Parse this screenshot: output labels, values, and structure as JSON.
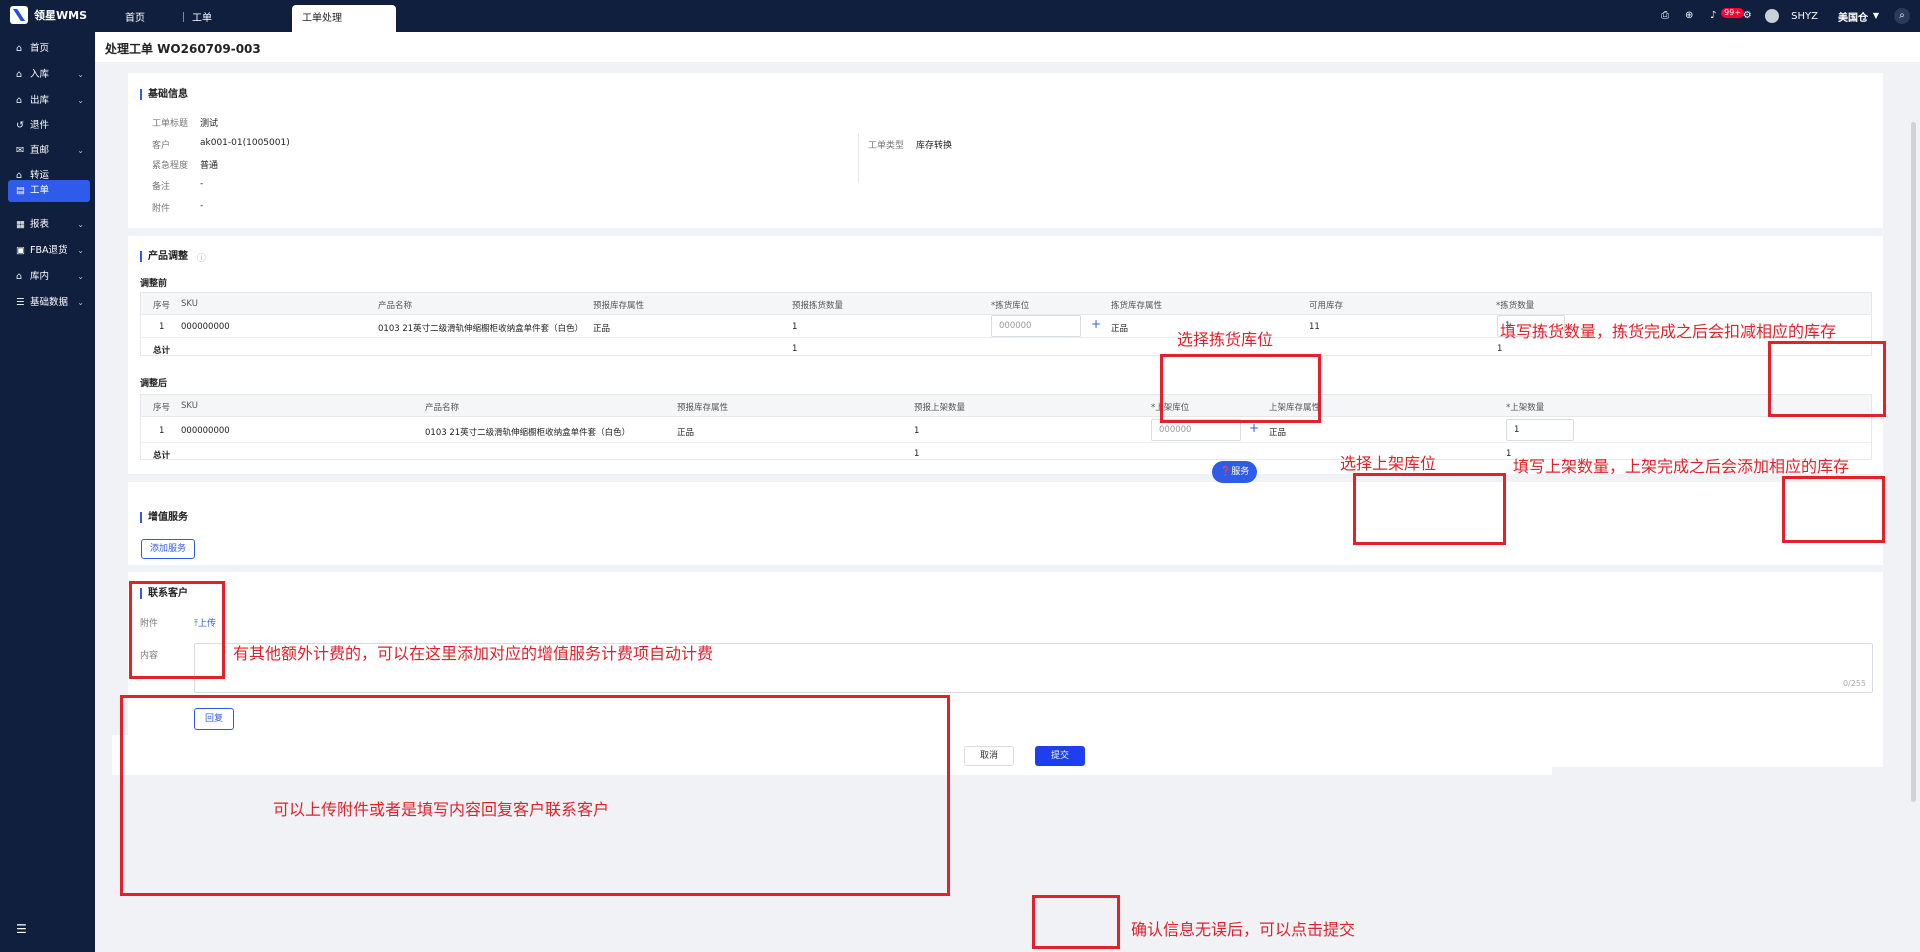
{
  "topbar": {
    "brand": "领星WMS",
    "tabs": [
      {
        "label": "首页"
      },
      {
        "label": "工单"
      },
      {
        "label": "工单处理"
      }
    ],
    "notif_count": "99+",
    "user": "SHYZ",
    "warehouse": "美国仓"
  },
  "sidebar": {
    "items": [
      {
        "label": "首页",
        "icon": "home-icon"
      },
      {
        "label": "入库",
        "icon": "inbound-icon"
      },
      {
        "label": "出库",
        "icon": "outbound-icon"
      },
      {
        "label": "退件",
        "icon": "return-icon"
      },
      {
        "label": "直邮",
        "icon": "direct-mail-icon"
      },
      {
        "label": "转运",
        "icon": "transfer-icon"
      },
      {
        "label": "工单",
        "icon": "workorder-icon"
      },
      {
        "label": "报表",
        "icon": "report-icon"
      },
      {
        "label": "FBA退货",
        "icon": "fba-return-icon"
      },
      {
        "label": "库内",
        "icon": "inventory-icon"
      },
      {
        "label": "基础数据",
        "icon": "base-data-icon"
      }
    ]
  },
  "page": {
    "title": "处理工单 WO260709-003"
  },
  "basic": {
    "title": "基础信息",
    "fields": [
      {
        "label": "工单标题",
        "value": "测试"
      },
      {
        "label": "客户",
        "value": "ak001-01(1005001)"
      },
      {
        "label": "紧急程度",
        "value": "普通"
      },
      {
        "label": "备注",
        "value": "-"
      },
      {
        "label": "附件",
        "value": "-"
      }
    ],
    "type_label": "工单类型",
    "type_value": "库存转换"
  },
  "adjust": {
    "title": "产品调整",
    "before_label": "调整前",
    "before_headers": [
      "序号",
      "SKU",
      "产品名称",
      "预报库存属性",
      "预报拣货数量",
      "*拣货库位",
      "拣货库存属性",
      "可用库存",
      "*拣货数量"
    ],
    "before_row": {
      "no": "1",
      "sku": "000000000",
      "name": "0103 21英寸二级滑轨伸缩橱柜收纳盒单件套（白色）",
      "attr": "正品",
      "qty": "1",
      "loc": "000000",
      "loc_attr": "正品",
      "avail": "11",
      "pick": "1"
    },
    "before_total": {
      "label": "总计",
      "qty": "1",
      "pick": "1"
    },
    "after_label": "调整后",
    "after_headers": [
      "序号",
      "SKU",
      "产品名称",
      "预报库存属性",
      "预报上架数量",
      "*上架库位",
      "上架库存属性",
      "*上架数量"
    ],
    "after_row": {
      "no": "1",
      "sku": "000000000",
      "name": "0103 21英寸二级滑轨伸缩橱柜收纳盒单件套（白色）",
      "attr": "正品",
      "qty": "1",
      "loc": "000000",
      "loc_attr": "正品",
      "put": "1"
    },
    "after_total": {
      "label": "总计",
      "qty": "1",
      "put": "1"
    }
  },
  "vas": {
    "title": "增值服务",
    "add_button": "添加服务"
  },
  "contact": {
    "title": "联系客户",
    "attach_label": "附件",
    "upload": "上传",
    "content_label": "内容",
    "counter": "0/255",
    "reply_button": "回复"
  },
  "float_service": "服务",
  "footer": {
    "cancel": "取消",
    "submit": "提交"
  },
  "annotations": {
    "pick_loc": "选择拣货库位",
    "pick_qty": "填写拣货数量，拣货完成之后会扣减相应的库存",
    "put_loc": "选择上架库位",
    "put_qty": "填写上架数量，上架完成之后会添加相应的库存",
    "vas": "有其他额外计费的，可以在这里添加对应的增值服务计费项自动计费",
    "contact": "可以上传附件或者是填写内容回复客户联系客户",
    "submit": "确认信息无误后，可以点击提交"
  }
}
